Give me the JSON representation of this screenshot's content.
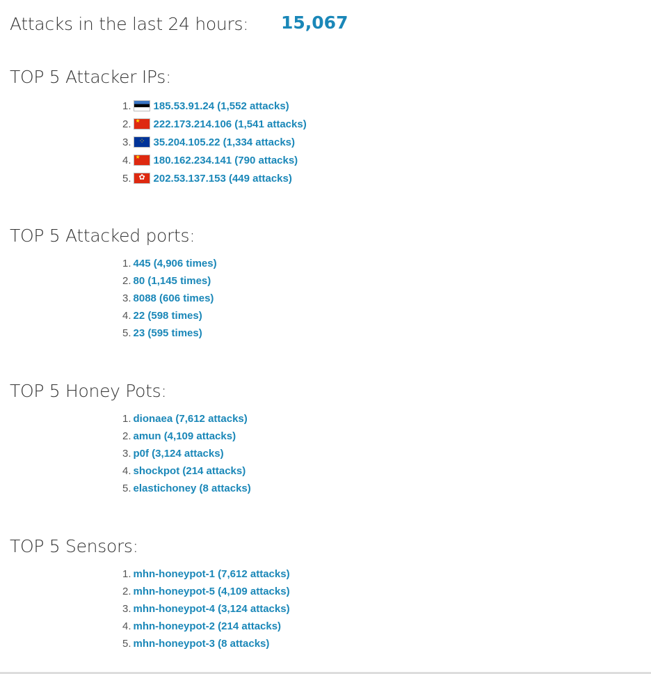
{
  "summary": {
    "label": "Attacks in the last 24 hours:",
    "value": "15,067"
  },
  "attacker_ips": {
    "title": "TOP 5 Attacker IPs:",
    "items": [
      {
        "num": "1.",
        "flag": "Estonia flag",
        "text": "185.53.91.24 (1,552 attacks)"
      },
      {
        "num": "2.",
        "flag": "China flag",
        "text": "222.173.214.106 (1,541 attacks)"
      },
      {
        "num": "3.",
        "flag": "European Union flag",
        "text": "35.204.105.22 (1,334 attacks)"
      },
      {
        "num": "4.",
        "flag": "China flag",
        "text": "180.162.234.141 (790 attacks)"
      },
      {
        "num": "5.",
        "flag": "Hong Kong flag",
        "text": "202.53.137.153 (449 attacks)"
      }
    ]
  },
  "attacked_ports": {
    "title": "TOP 5 Attacked ports:",
    "items": [
      {
        "num": "1.",
        "text": "445 (4,906 times)"
      },
      {
        "num": "2.",
        "text": "80 (1,145 times)"
      },
      {
        "num": "3.",
        "text": "8088 (606 times)"
      },
      {
        "num": "4.",
        "text": "22 (598 times)"
      },
      {
        "num": "5.",
        "text": "23 (595 times)"
      }
    ]
  },
  "honey_pots": {
    "title": "TOP 5 Honey Pots:",
    "items": [
      {
        "num": "1.",
        "text": "dionaea (7,612 attacks)"
      },
      {
        "num": "2.",
        "text": "amun (4,109 attacks)"
      },
      {
        "num": "3.",
        "text": "p0f (3,124 attacks)"
      },
      {
        "num": "4.",
        "text": "shockpot (214 attacks)"
      },
      {
        "num": "5.",
        "text": "elastichoney (8 attacks)"
      }
    ]
  },
  "sensors": {
    "title": "TOP 5 Sensors:",
    "items": [
      {
        "num": "1.",
        "text": "mhn-honeypot-1 (7,612 attacks)"
      },
      {
        "num": "2.",
        "text": "mhn-honeypot-5 (4,109 attacks)"
      },
      {
        "num": "3.",
        "text": "mhn-honeypot-4 (3,124 attacks)"
      },
      {
        "num": "4.",
        "text": "mhn-honeypot-2 (214 attacks)"
      },
      {
        "num": "5.",
        "text": "mhn-honeypot-3 (8 attacks)"
      }
    ]
  },
  "colors": {
    "link": "#1a87b8",
    "text": "#333333"
  }
}
